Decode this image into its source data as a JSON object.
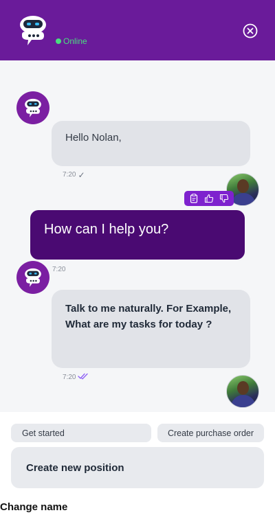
{
  "header": {
    "status": "Online",
    "brand_color": "#6a1b9a",
    "bot_icon": "chatbot-icon",
    "close_icon": "close-circle-icon"
  },
  "messages": [
    {
      "sender": "bot",
      "text": "Hello Nolan,",
      "time": "7:20",
      "status_icon": "check-icon"
    },
    {
      "sender": "user",
      "text": "How can I help you?",
      "time": "7:20",
      "reaction_icons": [
        "clipboard-icon",
        "thumbs-up-icon",
        "thumbs-down-icon"
      ]
    },
    {
      "sender": "bot",
      "text": "Talk to me naturally. For Example, What are my tasks for today ?",
      "time": "7:20",
      "status_icon": "double-check-icon"
    }
  ],
  "suggestions": {
    "chip1": "Get started",
    "chip2": "Create purchase order",
    "chip3": "Create new position"
  },
  "footer": {
    "label": "Change name"
  }
}
